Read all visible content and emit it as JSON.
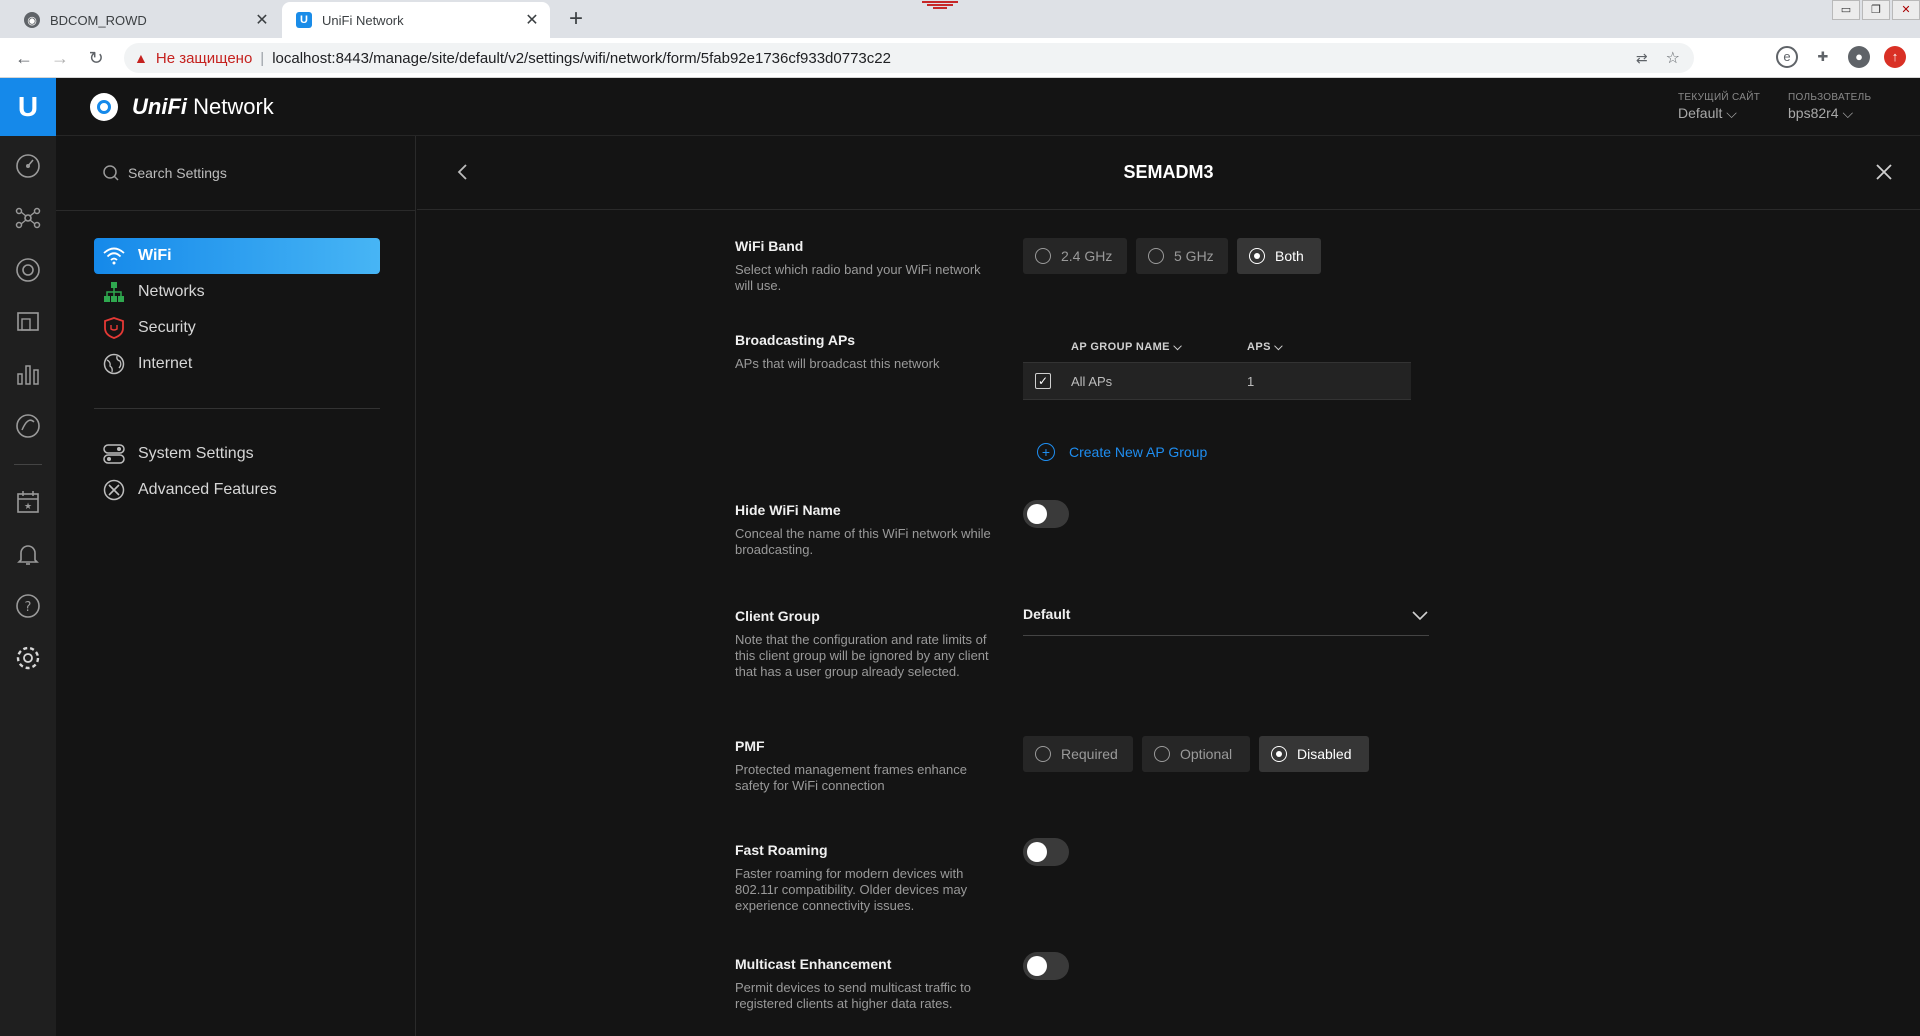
{
  "browser": {
    "tabs": [
      {
        "title": "BDCOM_ROWD",
        "active": false,
        "favicon": "globe-icon"
      },
      {
        "title": "UniFi Network",
        "active": true,
        "favicon": "unifi-icon"
      }
    ],
    "address": {
      "insecure_label": "Не защищено",
      "separator": "|",
      "url": "localhost:8443/manage/site/default/v2/settings/wifi/network/form/5fab92e1736cf933d0773c22"
    },
    "window_controls": {
      "minimize": "▭",
      "restore": "❐",
      "close": "✕"
    }
  },
  "app": {
    "brand": {
      "name_styled": "UniFi",
      "name_rest": "Network"
    },
    "site": {
      "caption": "ТЕКУЩИЙ САЙТ",
      "value": "Default"
    },
    "user": {
      "caption": "ПОЛЬЗОВАТЕЛЬ",
      "value": "bps82r4"
    },
    "accent": "#1589ea"
  },
  "sidebar": {
    "search_placeholder": "Search Settings",
    "items": [
      {
        "label": "WiFi",
        "icon": "wifi-icon",
        "selected": true
      },
      {
        "label": "Networks",
        "icon": "network-icon",
        "selected": false
      },
      {
        "label": "Security",
        "icon": "shield-icon",
        "selected": false
      },
      {
        "label": "Internet",
        "icon": "globe-icon",
        "selected": false
      }
    ],
    "secondary_items": [
      {
        "label": "System Settings",
        "icon": "toggles-icon"
      },
      {
        "label": "Advanced Features",
        "icon": "tools-icon"
      }
    ]
  },
  "form": {
    "title": "SEMADM3",
    "wifi_band": {
      "title": "WiFi Band",
      "description": "Select which radio band your WiFi network will use.",
      "options": [
        "2.4 GHz",
        "5 GHz",
        "Both"
      ],
      "selected": "Both"
    },
    "broadcasting_aps": {
      "title": "Broadcasting APs",
      "description": "APs that will broadcast this network",
      "columns": [
        "AP GROUP NAME",
        "APS"
      ],
      "rows": [
        {
          "name": "All APs",
          "aps": "1",
          "checked": true
        }
      ],
      "create_label": "Create New AP Group"
    },
    "hide_wifi_name": {
      "title": "Hide WiFi Name",
      "description": "Conceal the name of this WiFi network while broadcasting.",
      "enabled": false
    },
    "client_group": {
      "title": "Client Group",
      "description": "Note that the configuration and rate limits of this client group will be ignored by any client that has a user group already selected.",
      "value": "Default"
    },
    "pmf": {
      "title": "PMF",
      "description": "Protected management frames enhance safety for WiFi connection",
      "options": [
        "Required",
        "Optional",
        "Disabled"
      ],
      "selected": "Disabled"
    },
    "fast_roaming": {
      "title": "Fast Roaming",
      "description": "Faster roaming for modern devices with 802.11r compatibility. Older devices may experience connectivity issues.",
      "enabled": false
    },
    "multicast": {
      "title": "Multicast Enhancement",
      "description": "Permit devices to send multicast traffic to registered clients at higher data rates.",
      "enabled": false
    }
  }
}
